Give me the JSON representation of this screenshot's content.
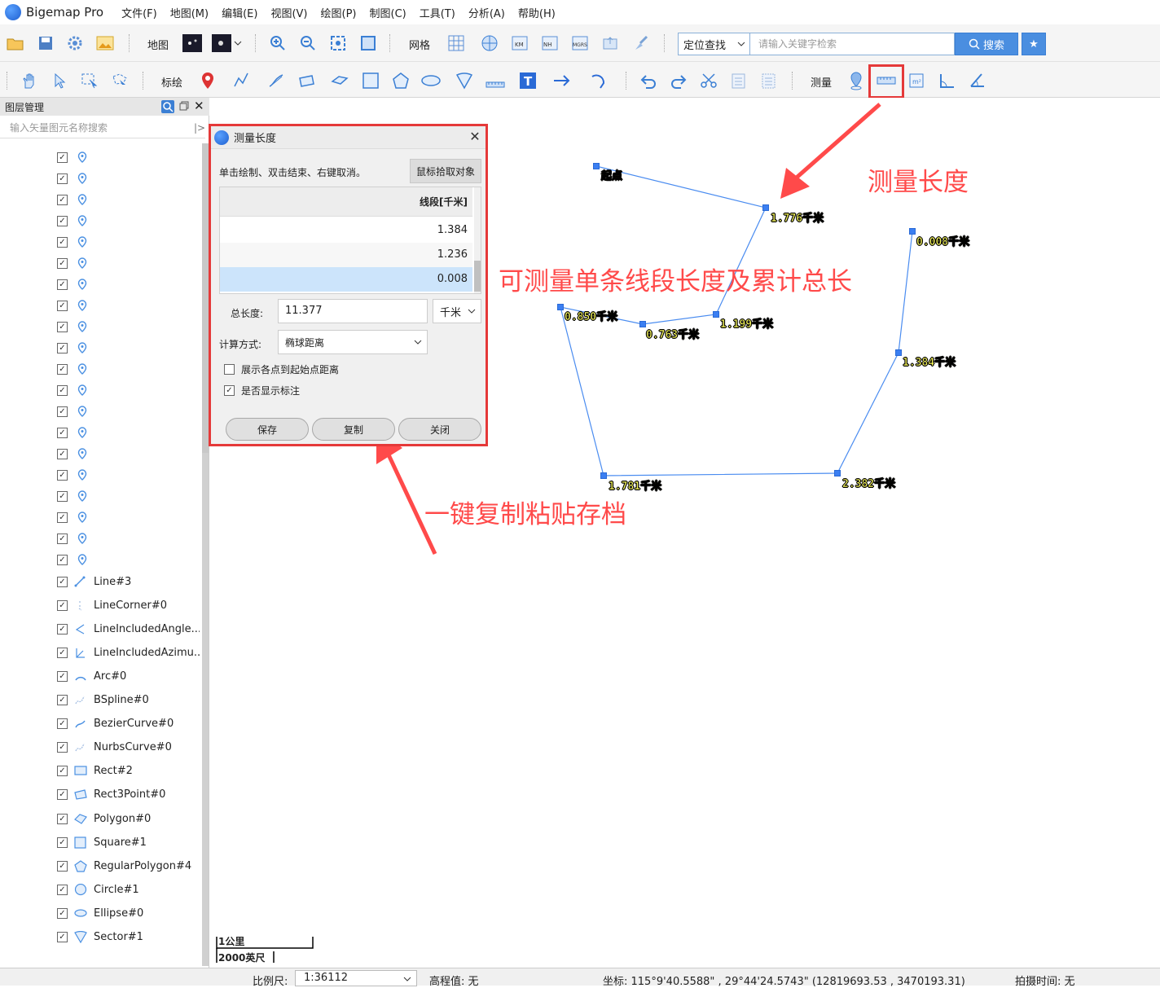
{
  "app": {
    "title": "Bigemap Pro"
  },
  "menu": [
    "文件(F)",
    "地图(M)",
    "编辑(E)",
    "视图(V)",
    "绘图(P)",
    "制图(C)",
    "工具(T)",
    "分析(A)",
    "帮助(H)"
  ],
  "toolbar1": {
    "map_label": "地图",
    "grid_label": "网格",
    "locate_select": "定位查找",
    "search_placeholder": "请输入关键字检索",
    "search_button": "搜索"
  },
  "toolbar2": {
    "annotate_label": "标绘",
    "measure_label": "测量"
  },
  "layer_panel": {
    "title": "图层管理",
    "search_placeholder": "输入矢量图元名称搜索",
    "named_layers": [
      "Line#3",
      "LineCorner#0",
      "LineIncludedAngle...",
      "LineIncludedAzimu...",
      "Arc#0",
      "BSpline#0",
      "BezierCurve#0",
      "NurbsCurve#0",
      "Rect#2",
      "Rect3Point#0",
      "Polygon#0",
      "Square#1",
      "RegularPolygon#4",
      "Circle#1",
      "Ellipse#0",
      "Sector#1"
    ]
  },
  "dialog": {
    "title": "测量长度",
    "hint": "单击绘制、双击结束、右键取消。",
    "pick_button": "鼠标拾取对象",
    "column_header": "线段[千米]",
    "rows": [
      "1.384",
      "1.236",
      "0.008"
    ],
    "total_label": "总长度:",
    "total_value": "11.377",
    "unit": "千米",
    "calc_label": "计算方式:",
    "calc_value": "椭球距离",
    "check1_label": "展示各点到起始点距离",
    "check2_label": "是否显示标注",
    "save_button": "保存",
    "copy_button": "复制",
    "close_button": "关闭"
  },
  "map_labels": {
    "start": "起点",
    "l1": "1.776千米",
    "l2": "0.008千米",
    "l3": "0.850千米",
    "l4": "0.763千米",
    "l5": "1.199千米",
    "l6": "1.384千米",
    "l7": "1.781千米",
    "l8": "2.382千米"
  },
  "annotations": {
    "measure_length": "测量长度",
    "measure_desc": "可测量单条线段长度及累计总长",
    "copy_desc": "一键复制粘贴存档"
  },
  "scalebar": {
    "km": "1公里",
    "ft": "2000英尺"
  },
  "status": {
    "scale_label": "比例尺:",
    "scale_value": "1:36112",
    "elevation": "高程值: 无",
    "coords": "坐标: 115°9'40.5588\" , 29°44'24.5743\" (12819693.53 , 3470193.31)",
    "capture_time": "拍摄时间: 无"
  },
  "colors": {
    "accent": "#4a8ee0",
    "highlight": "#e53939",
    "line": "#4a8cf0",
    "label": "#ffff60"
  }
}
